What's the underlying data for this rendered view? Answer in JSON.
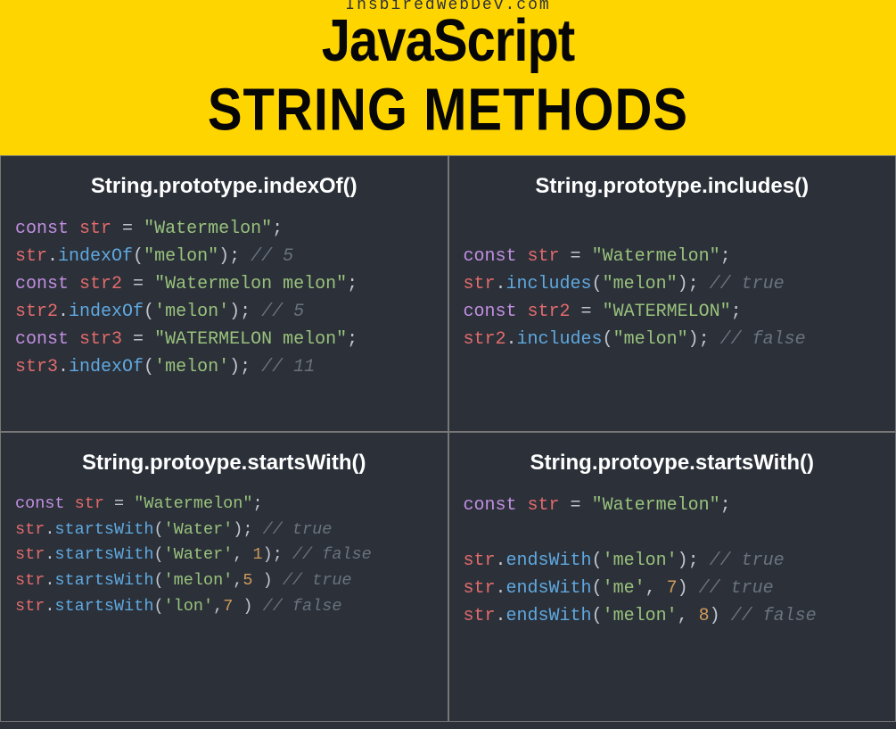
{
  "header": {
    "site": "InspiredWebDev.com",
    "title1": "JavaScript",
    "title2": "STRING METHODS"
  },
  "cells": [
    {
      "title": "String.prototype.indexOf()",
      "lines": [
        [
          [
            "kw",
            "const"
          ],
          [
            "op",
            " "
          ],
          [
            "ident",
            "str"
          ],
          [
            "op",
            " = "
          ],
          [
            "str",
            "\"Watermelon\""
          ],
          [
            "op",
            ";"
          ]
        ],
        [
          [
            "ident",
            "str"
          ],
          [
            "op",
            "."
          ],
          [
            "fn",
            "indexOf"
          ],
          [
            "op",
            "("
          ],
          [
            "str",
            "\"melon\""
          ],
          [
            "op",
            "); "
          ],
          [
            "cm",
            "// 5"
          ]
        ],
        [
          [
            "kw",
            "const"
          ],
          [
            "op",
            " "
          ],
          [
            "ident",
            "str2"
          ],
          [
            "op",
            " = "
          ],
          [
            "str",
            "\"Watermelon melon\""
          ],
          [
            "op",
            ";"
          ]
        ],
        [
          [
            "ident",
            "str2"
          ],
          [
            "op",
            "."
          ],
          [
            "fn",
            "indexOf"
          ],
          [
            "op",
            "("
          ],
          [
            "str",
            "'melon'"
          ],
          [
            "op",
            "); "
          ],
          [
            "cm",
            "// 5"
          ]
        ],
        [
          [
            "kw",
            "const"
          ],
          [
            "op",
            " "
          ],
          [
            "ident",
            "str3"
          ],
          [
            "op",
            " = "
          ],
          [
            "str",
            "\"WATERMELON melon\""
          ],
          [
            "op",
            ";"
          ]
        ],
        [
          [
            "ident",
            "str3"
          ],
          [
            "op",
            "."
          ],
          [
            "fn",
            "indexOf"
          ],
          [
            "op",
            "("
          ],
          [
            "str",
            "'melon'"
          ],
          [
            "op",
            "); "
          ],
          [
            "cm",
            "// 11"
          ]
        ]
      ],
      "size": "normal"
    },
    {
      "title": "String.prototype.includes()",
      "lines": [
        [
          [
            "op",
            ""
          ]
        ],
        [
          [
            "kw",
            "const"
          ],
          [
            "op",
            " "
          ],
          [
            "ident",
            "str"
          ],
          [
            "op",
            " = "
          ],
          [
            "str",
            "\"Watermelon\""
          ],
          [
            "op",
            ";"
          ]
        ],
        [
          [
            "ident",
            "str"
          ],
          [
            "op",
            "."
          ],
          [
            "fn",
            "includes"
          ],
          [
            "op",
            "("
          ],
          [
            "str",
            "\"melon\""
          ],
          [
            "op",
            "); "
          ],
          [
            "cm",
            "// true"
          ]
        ],
        [
          [
            "kw",
            "const"
          ],
          [
            "op",
            " "
          ],
          [
            "ident",
            "str2"
          ],
          [
            "op",
            " = "
          ],
          [
            "str",
            "\"WATERMELON\""
          ],
          [
            "op",
            ";"
          ]
        ],
        [
          [
            "ident",
            "str2"
          ],
          [
            "op",
            "."
          ],
          [
            "fn",
            "includes"
          ],
          [
            "op",
            "("
          ],
          [
            "str",
            "\"melon\""
          ],
          [
            "op",
            "); "
          ],
          [
            "cm",
            "// false"
          ]
        ]
      ],
      "size": "normal"
    },
    {
      "title": "String.protoype.startsWith()",
      "lines": [
        [
          [
            "kw",
            "const"
          ],
          [
            "op",
            " "
          ],
          [
            "ident",
            "str"
          ],
          [
            "op",
            " = "
          ],
          [
            "str",
            "\"Watermelon\""
          ],
          [
            "op",
            ";"
          ]
        ],
        [
          [
            "ident",
            "str"
          ],
          [
            "op",
            "."
          ],
          [
            "fn",
            "startsWith"
          ],
          [
            "op",
            "("
          ],
          [
            "str",
            "'Water'"
          ],
          [
            "op",
            "); "
          ],
          [
            "cm",
            "// true"
          ]
        ],
        [
          [
            "ident",
            "str"
          ],
          [
            "op",
            "."
          ],
          [
            "fn",
            "startsWith"
          ],
          [
            "op",
            "("
          ],
          [
            "str",
            "'Water'"
          ],
          [
            "op",
            ", "
          ],
          [
            "num",
            "1"
          ],
          [
            "op",
            "); "
          ],
          [
            "cm",
            "// false"
          ]
        ],
        [
          [
            "ident",
            "str"
          ],
          [
            "op",
            "."
          ],
          [
            "fn",
            "startsWith"
          ],
          [
            "op",
            "("
          ],
          [
            "str",
            "'melon'"
          ],
          [
            "op",
            ","
          ],
          [
            "num",
            "5"
          ],
          [
            "op",
            " ) "
          ],
          [
            "cm",
            "// true"
          ]
        ],
        [
          [
            "ident",
            "str"
          ],
          [
            "op",
            "."
          ],
          [
            "fn",
            "startsWith"
          ],
          [
            "op",
            "("
          ],
          [
            "str",
            "'lon'"
          ],
          [
            "op",
            ","
          ],
          [
            "num",
            "7"
          ],
          [
            "op",
            " ) "
          ],
          [
            "cm",
            "// false"
          ]
        ]
      ],
      "size": "small"
    },
    {
      "title": "String.protoype.startsWith()",
      "lines": [
        [
          [
            "kw",
            "const"
          ],
          [
            "op",
            " "
          ],
          [
            "ident",
            "str"
          ],
          [
            "op",
            " = "
          ],
          [
            "str",
            "\"Watermelon\""
          ],
          [
            "op",
            ";"
          ]
        ],
        [
          [
            "op",
            " "
          ]
        ],
        [
          [
            "ident",
            "str"
          ],
          [
            "op",
            "."
          ],
          [
            "fn",
            "endsWith"
          ],
          [
            "op",
            "("
          ],
          [
            "str",
            "'melon'"
          ],
          [
            "op",
            "); "
          ],
          [
            "cm",
            "// true"
          ]
        ],
        [
          [
            "ident",
            "str"
          ],
          [
            "op",
            "."
          ],
          [
            "fn",
            "endsWith"
          ],
          [
            "op",
            "("
          ],
          [
            "str",
            "'me'"
          ],
          [
            "op",
            ", "
          ],
          [
            "num",
            "7"
          ],
          [
            "op",
            ") "
          ],
          [
            "cm",
            "// true"
          ]
        ],
        [
          [
            "ident",
            "str"
          ],
          [
            "op",
            "."
          ],
          [
            "fn",
            "endsWith"
          ],
          [
            "op",
            "("
          ],
          [
            "str",
            "'melon'"
          ],
          [
            "op",
            ", "
          ],
          [
            "num",
            "8"
          ],
          [
            "op",
            ") "
          ],
          [
            "cm",
            "// false"
          ]
        ]
      ],
      "size": "normal"
    }
  ]
}
